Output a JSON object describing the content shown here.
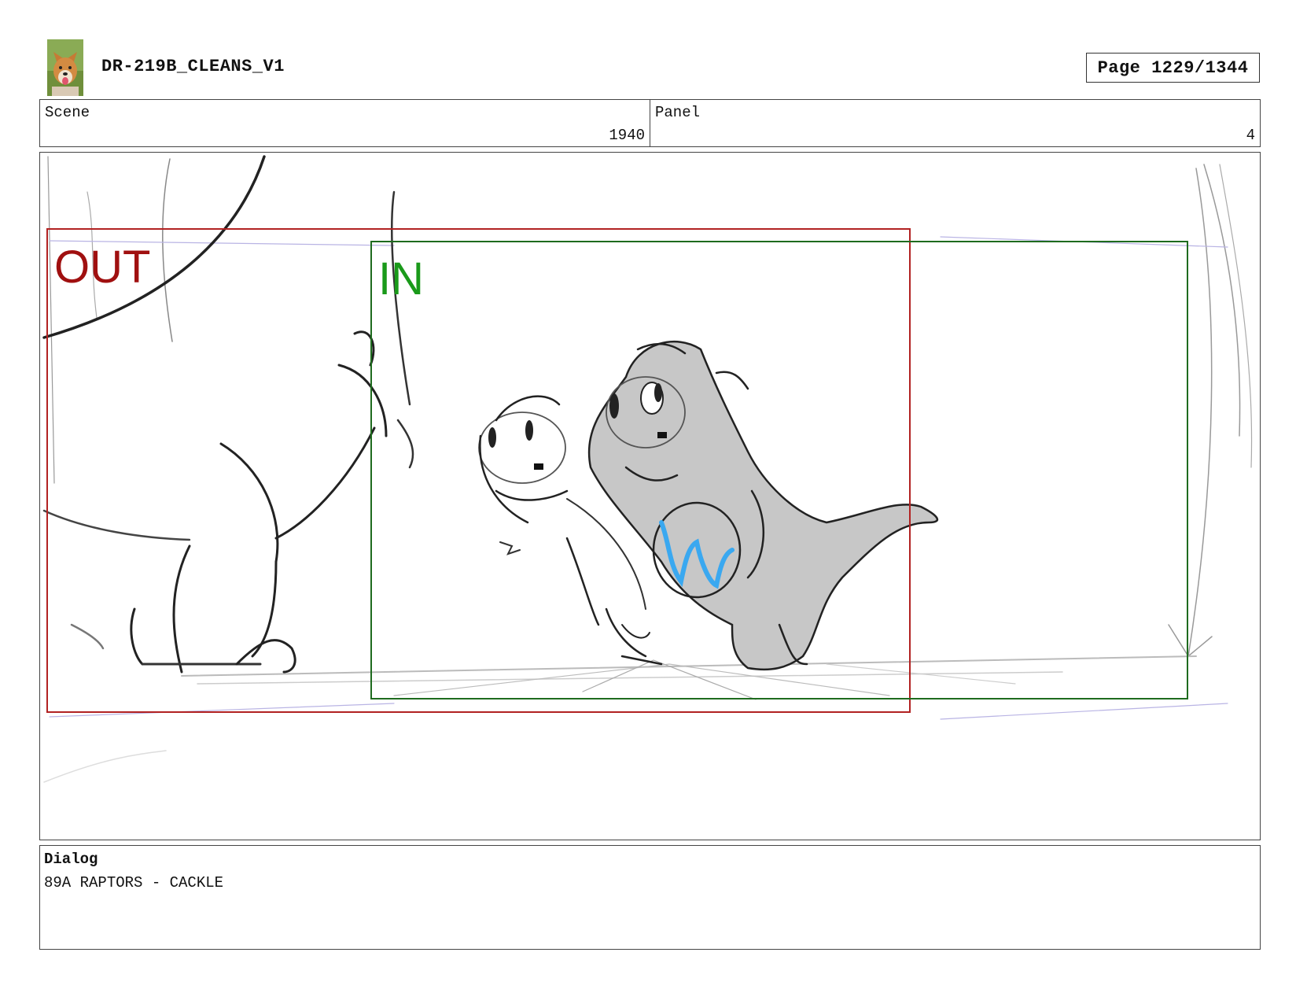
{
  "header": {
    "title": "DR-219B_CLEANS_V1",
    "page_label": "Page 1229/1344"
  },
  "info": {
    "scene_label": "Scene",
    "scene_value": "1940",
    "panel_label": "Panel",
    "panel_value": "4"
  },
  "frame": {
    "out_label": "OUT",
    "in_label": "IN",
    "out_color": "#a01010",
    "in_color": "#1a9a1a",
    "out_frame_color": "#b22222",
    "in_frame_color": "#1e6b1e",
    "accent_color": "#3aa8f0"
  },
  "dialog": {
    "label": "Dialog",
    "text": "89A RAPTORS - CACKLE"
  },
  "icons": {
    "logo": "dog-avatar-icon"
  }
}
